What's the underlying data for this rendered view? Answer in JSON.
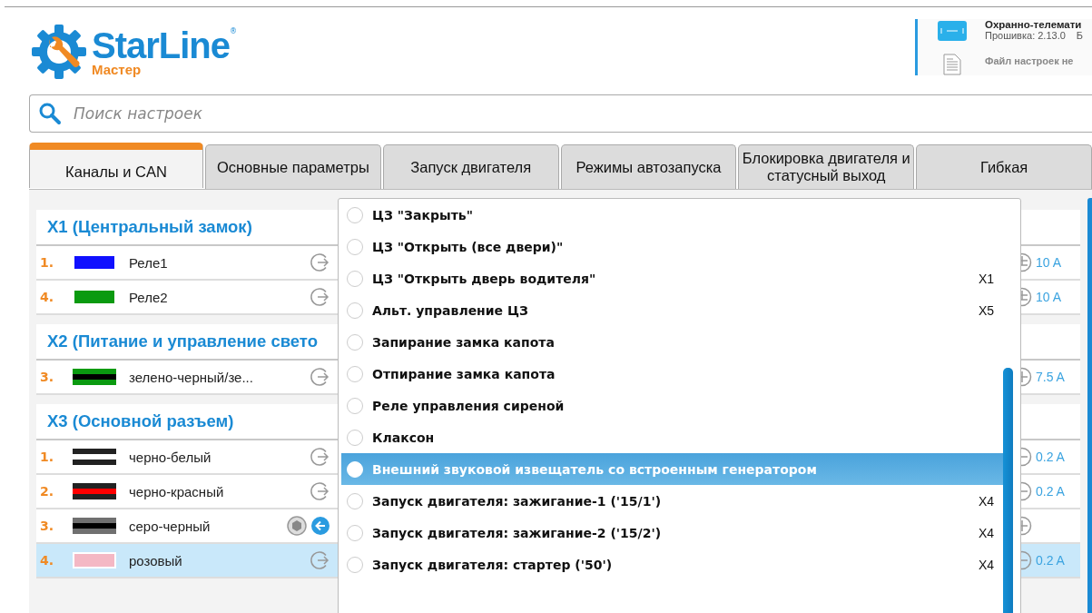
{
  "header": {
    "logo_name": "StarLine",
    "logo_mark": "®",
    "logo_subtitle": "Мастер",
    "device_title": "Охранно-телемати",
    "firmware": "Прошивка: 2.13.0",
    "firmware_extra": "Б",
    "file_status": "Файл настроек не"
  },
  "search": {
    "placeholder": "Поиск настроек"
  },
  "tabs": [
    {
      "label": "Каналы и CAN",
      "selected": true
    },
    {
      "label": "Основные параметры",
      "selected": false
    },
    {
      "label": "Запуск двигателя",
      "selected": false
    },
    {
      "label": "Режимы автозапуска",
      "selected": false
    },
    {
      "label": "Блокировка двигателя и статусный выход",
      "selected": false
    },
    {
      "label": "Гибкая",
      "selected": false
    }
  ],
  "sections": [
    {
      "title": "X1 (Центральный замок)",
      "rows": [
        {
          "number": "1.",
          "stripes": [
            {
              "color": "#1010ff"
            }
          ],
          "label": "Реле1",
          "active": false,
          "selected": false,
          "kind": "plus-minus",
          "current": "10 A"
        },
        {
          "number": "4.",
          "stripes": [
            {
              "color": "#0a9a10"
            }
          ],
          "label": "Реле2",
          "active": false,
          "selected": false,
          "kind": "plus-minus",
          "current": "10 A"
        }
      ]
    },
    {
      "title": "X2 (Питание и управление свето",
      "rows": [
        {
          "number": "3.",
          "stripes": [
            {
              "color": "#0a9a10"
            },
            {
              "color": "#000000"
            },
            {
              "color": "#0a9a10"
            }
          ],
          "label": "зелено-черный/зе...",
          "active": false,
          "selected": false,
          "kind": "plus",
          "current": "7.5 A"
        }
      ]
    },
    {
      "title": "X3 (Основной разъем)",
      "rows": [
        {
          "number": "1.",
          "stripes": [
            {
              "color": "#222222"
            },
            {
              "color": "#ffffff"
            },
            {
              "color": "#222222"
            }
          ],
          "label": "черно-белый",
          "active": false,
          "selected": false,
          "kind": "minus",
          "current": "0.2 A"
        },
        {
          "number": "2.",
          "stripes": [
            {
              "color": "#222222"
            },
            {
              "color": "#ff0000"
            },
            {
              "color": "#222222"
            }
          ],
          "label": "черно-красный",
          "active": false,
          "selected": false,
          "kind": "minus",
          "current": "0.2 A"
        },
        {
          "number": "3.",
          "stripes": [
            {
              "color": "#707070"
            },
            {
              "color": "#000000"
            },
            {
              "color": "#707070"
            }
          ],
          "label": "серо-черный",
          "active": true,
          "selected": false,
          "kind": "plus"
        },
        {
          "number": "4.",
          "stripes": [
            {
              "color": "#f4b8c4"
            }
          ],
          "label": "розовый",
          "active": false,
          "selected": true,
          "kind": "minus",
          "current": "0.2 A"
        }
      ]
    }
  ],
  "dropdown": {
    "items": [
      {
        "label": "ЦЗ \"Закрыть\"",
        "highlighted": false
      },
      {
        "label": "ЦЗ \"Открыть (все двери)\"",
        "highlighted": false
      },
      {
        "label": "ЦЗ \"Открыть дверь водителя\"",
        "connector": "X1",
        "highlighted": false
      },
      {
        "label": "Альт. управление ЦЗ",
        "connector": "X5",
        "highlighted": false
      },
      {
        "label": "Запирание замка капота",
        "highlighted": false
      },
      {
        "label": "Отпирание замка капота",
        "highlighted": false
      },
      {
        "label": "Реле управления сиреной",
        "highlighted": false
      },
      {
        "label": "Клаксон",
        "highlighted": false
      },
      {
        "label": "Внешний звуковой извещатель со встроенным генератором",
        "highlighted": true
      },
      {
        "label": "Запуск двигателя: зажигание-1 ('15/1')",
        "connector": "X4",
        "highlighted": false
      },
      {
        "label": "Запуск двигателя: зажигание-2 ('15/2')",
        "connector": "X4",
        "highlighted": false
      },
      {
        "label": "Запуск двигателя: стартер ('50')",
        "connector": "X4",
        "highlighted": false
      }
    ]
  }
}
